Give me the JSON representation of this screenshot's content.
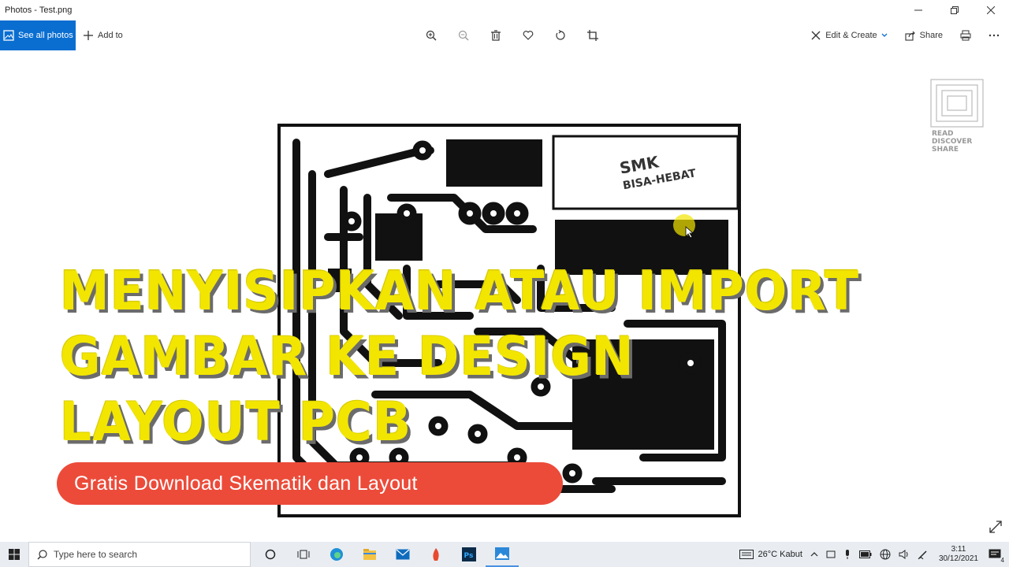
{
  "window": {
    "title": "Photos - Test.png"
  },
  "toolbar": {
    "see_all_label": "See all photos",
    "add_to_label": "Add to",
    "edit_create_label": "Edit & Create",
    "share_label": "Share"
  },
  "overlay": {
    "title_lines": [
      "MENYISIPKAN ATAU IMPORT",
      "GAMBAR KE DESIGN",
      "LAYOUT PCB"
    ],
    "banner": "Gratis Download Skematik dan Layout"
  },
  "pcb_logo": {
    "line1": "SMK",
    "line2": "BISA-HEBAT"
  },
  "watermark": {
    "line1": "READ",
    "line2": "DISCOVER",
    "line3": "SHARE"
  },
  "taskbar": {
    "search_placeholder": "Type here to search",
    "weather": "26°C  Kabut",
    "time": "3:11",
    "date": "30/12/2021",
    "notification_count": "4"
  },
  "colors": {
    "accent": "#0a6ed1",
    "title_yellow": "#f2e600",
    "banner_red": "#ec4b3a"
  }
}
